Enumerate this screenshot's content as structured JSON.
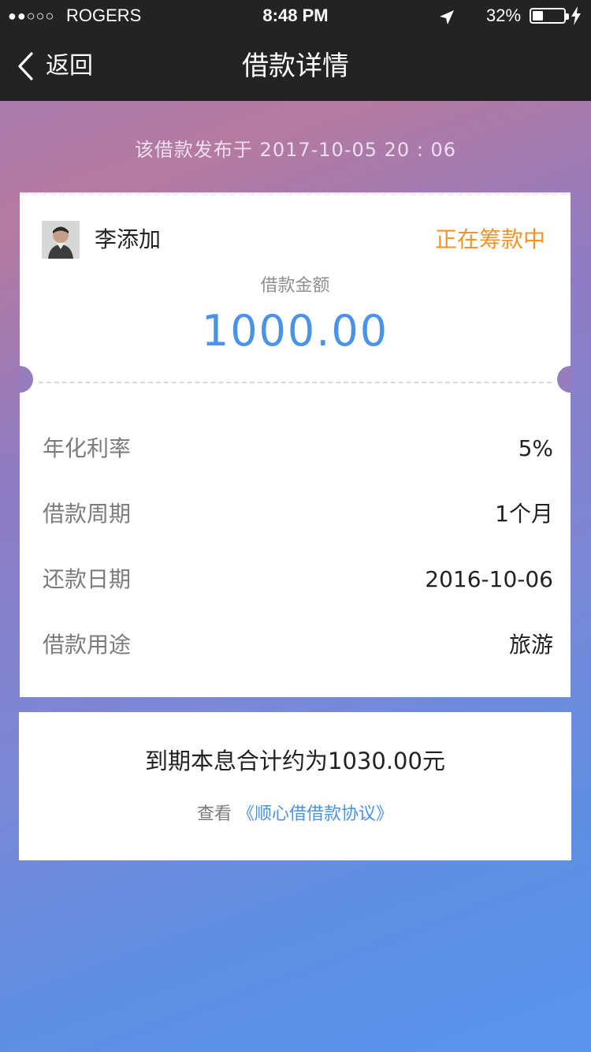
{
  "status_bar": {
    "signal": "●●○○○",
    "carrier": "ROGERS",
    "time": "8:48 PM",
    "battery": "32%",
    "icons": [
      "location-arrow-icon",
      "battery-icon",
      "charging-bolt-icon"
    ]
  },
  "nav": {
    "back_label": "返回",
    "title": "借款详情"
  },
  "publish": {
    "text": "该借款发布于 2017-10-05  20 : 06"
  },
  "loan": {
    "borrower_name": "李添加",
    "status": "正在筹款中",
    "amount_label": "借款金额",
    "amount_value": "1000.00",
    "details": [
      {
        "label": "年化利率",
        "value": "5%"
      },
      {
        "label": "借款周期",
        "value": "1个月"
      },
      {
        "label": "还款日期",
        "value": "2016-10-06"
      },
      {
        "label": "借款用途",
        "value": "旅游"
      }
    ]
  },
  "summary": {
    "total": "到期本息合计约为1030.00元",
    "agreement_prefix": "查看",
    "agreement_link": "《顺心借借款协议》"
  },
  "colors": {
    "nav_background": "#232323",
    "status_orange": "#f49428",
    "accent_blue": "#4b93e9"
  }
}
